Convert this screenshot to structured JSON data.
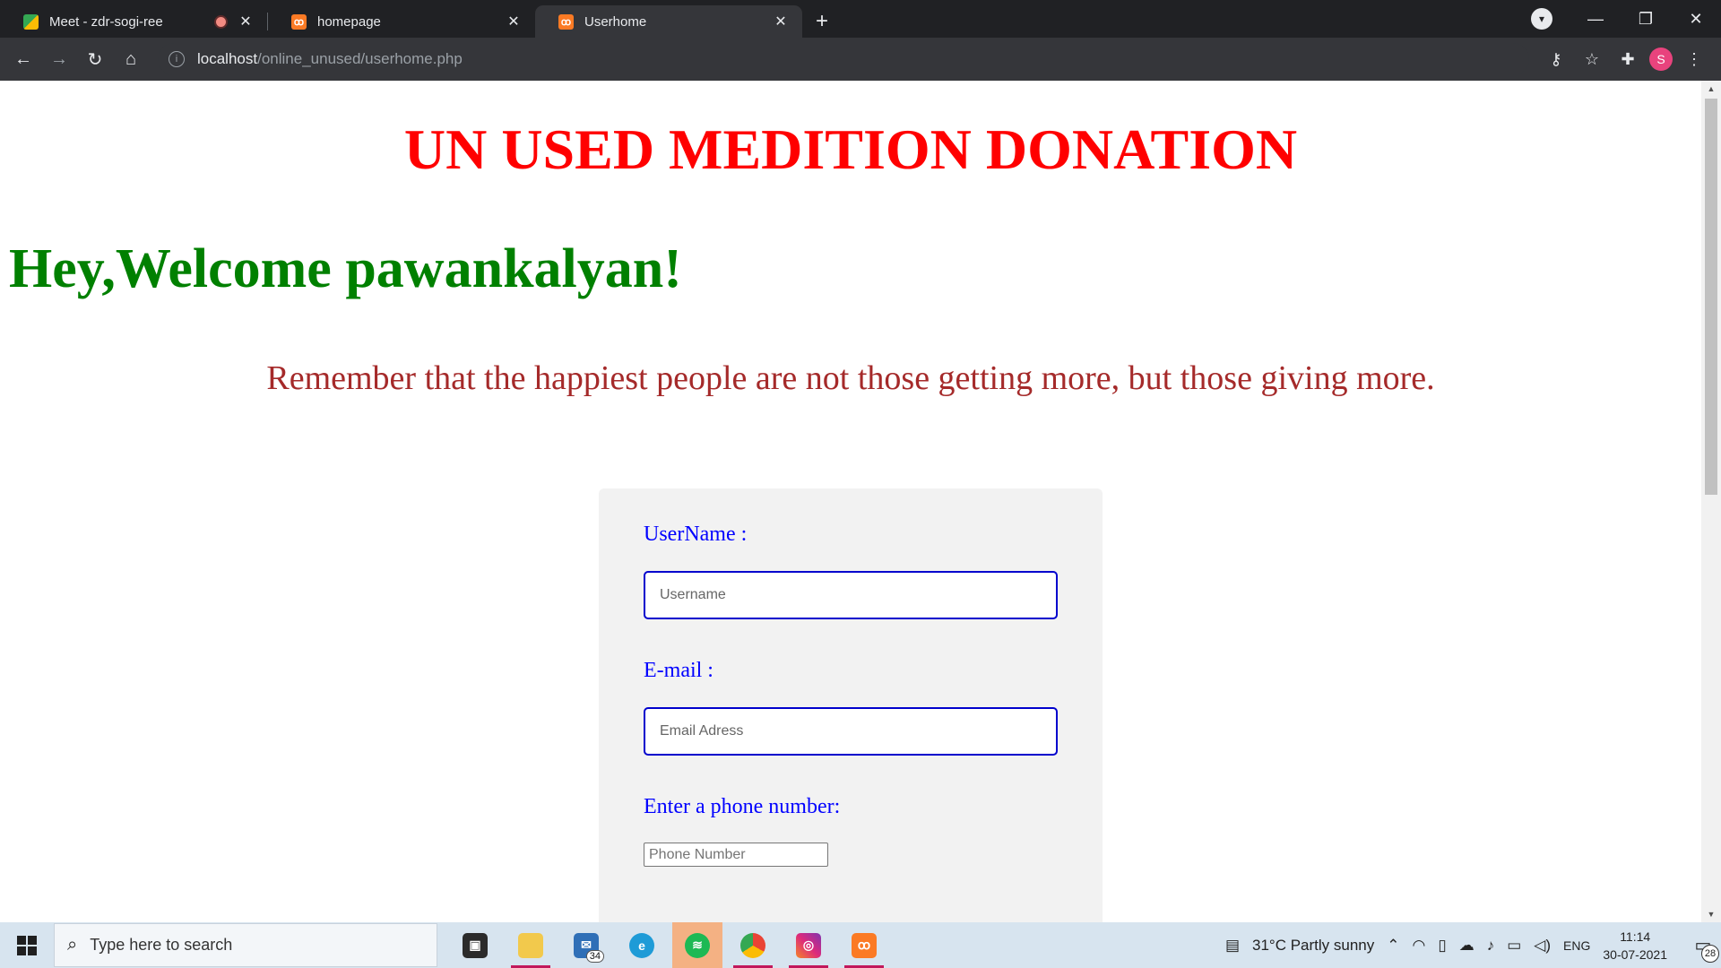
{
  "browser": {
    "tabs": [
      {
        "label": "Meet - zdr-sogi-ree",
        "favicon": "google-meet-icon",
        "recording": true
      },
      {
        "label": "homepage",
        "favicon": "xampp-icon"
      },
      {
        "label": "Userhome",
        "favicon": "xampp-icon",
        "active": true
      }
    ],
    "url_host": "localhost",
    "url_path": "/online_unused/userhome.php",
    "profile_initial": "S"
  },
  "page": {
    "title": "UN USED MEDITION DONATION",
    "title_color": "#ff0000",
    "welcome": "Hey,Welcome pawankalyan!",
    "welcome_color": "#008000",
    "quote": "Remember that the happiest people are not those getting more, but those giving more.",
    "quote_color": "#a52a2a",
    "form": {
      "username_label": "UserName :",
      "username_placeholder": "Username",
      "email_label": "E-mail :",
      "email_placeholder": "Email Adress",
      "phone_label": "Enter a phone number:",
      "phone_placeholder": "Phone Number"
    }
  },
  "taskbar": {
    "search_placeholder": "Type here to search",
    "mail_badge": "34",
    "weather": "31°C  Partly sunny",
    "language": "ENG",
    "time": "11:14",
    "date": "30-07-2021",
    "notification_count": "28"
  }
}
